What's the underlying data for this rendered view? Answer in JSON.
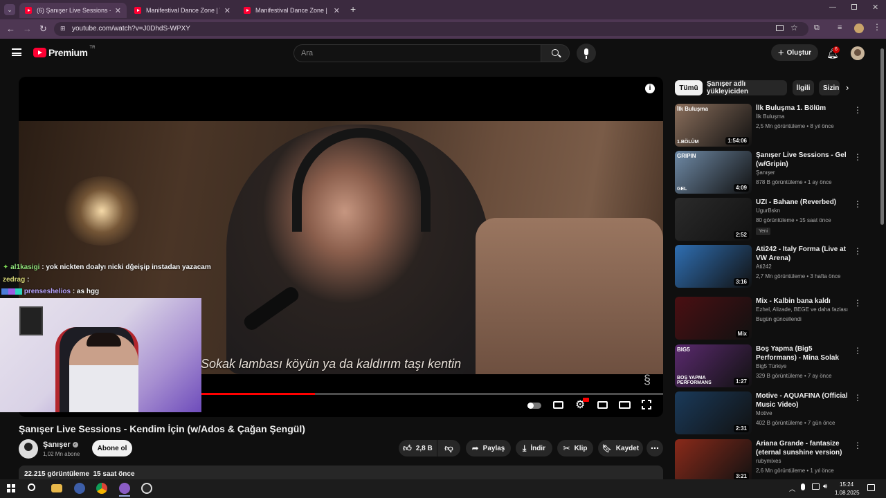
{
  "browser": {
    "tabs": [
      {
        "title": "(6) Şanışer Live Sessions - Kend",
        "active": true
      },
      {
        "title": "Manifestival Dance Zone | Tean",
        "active": false
      },
      {
        "title": "Manifestival Dance Zone | Big-I",
        "active": false
      }
    ],
    "url": "youtube.com/watch?v=J0DhdS-WPXY"
  },
  "header": {
    "logo": "Premium",
    "region": "TR",
    "search_placeholder": "Ara",
    "create_label": "Oluştur",
    "notif_count": "6"
  },
  "player": {
    "subtitle": "Sokak lambası köyün ya da kaldırım taşı kentin",
    "progress_fraction": 0.46
  },
  "chat": [
    {
      "user": "al1kasigi",
      "text": ": yok nickten doalyı nicki dğeişip instadan yazacam"
    },
    {
      "user": "zedrag",
      "text": ":"
    },
    {
      "user": "prenseshelios",
      "text": ": as hgg"
    }
  ],
  "video": {
    "title": "Şanışer Live Sessions - Kendim İçin (w/Ados & Çağan Şengül)",
    "channel": "Şanışer",
    "subscribers": "1,02 Mn abone",
    "subscribe_label": "Abone ol",
    "likes": "2,8 B",
    "share_label": "Paylaş",
    "download_label": "İndir",
    "clip_label": "Klip",
    "save_label": "Kaydet",
    "views": "22.215 görüntüleme",
    "published": "15 saat önce"
  },
  "chips": [
    "Tümü",
    "Şanışer adlı yükleyiciden",
    "İlgili",
    "Sizin"
  ],
  "recommendations": [
    {
      "title": "İlk Buluşma 1. Bölüm",
      "channel": "İlk Buluşma",
      "meta": "2,5 Mn görüntüleme • 8 yıl önce",
      "duration": "1:54:06",
      "thumb_label": "İlk Buluşma",
      "thumb_label2": "1.BÖLÜM",
      "thumb_color": "#8b6f5c"
    },
    {
      "title": "Şanışer Live Sessions - Gel (w/Gripin)",
      "channel": "Şanışer",
      "meta": "878 B görüntüleme • 1 ay önce",
      "duration": "4:09",
      "thumb_label": "GRIPIN",
      "thumb_label2": "GEL",
      "thumb_color": "#6f8aa6"
    },
    {
      "title": "UZI - Bahane (Reverbed)",
      "channel": "UgurBskn",
      "meta": "80 görüntüleme • 15 saat önce",
      "duration": "2:52",
      "badge": "Yeni",
      "thumb_color": "#2b2b2b"
    },
    {
      "title": "Ati242 - Italy Forma (Live at VW Arena)",
      "channel": "Ati242",
      "meta": "2,7 Mn görüntüleme • 3 hafta önce",
      "duration": "3:16",
      "thumb_color": "#2f6fb3"
    },
    {
      "title": "Mix - Kalbin bana kaldı",
      "channel": "Ezhel, Alizade, BEGE ve daha fazlası",
      "meta": "Bugün güncellendi",
      "duration": "Mix",
      "thumb_color": "#4a0f12"
    },
    {
      "title": "Boş Yapma (Big5 Performans) - Mina Solak",
      "channel": "Big5 Türkiye",
      "meta": "329 B görüntüleme • 7 ay önce",
      "duration": "1:27",
      "thumb_label": "BIG5",
      "thumb_label2": "BOŞ YAPMA PERFORMANS",
      "thumb_color": "#5a2a6e"
    },
    {
      "title": "Motive - AQUAFINA (Official Music Video)",
      "channel": "Motive",
      "meta": "402 B görüntüleme • 7 gün önce",
      "duration": "2:31",
      "thumb_color": "#1a3a5a"
    },
    {
      "title": "Ariana Grande - fantasize (eternal sunshine version)",
      "channel": "rubymixes",
      "meta": "2,6 Mn görüntüleme • 1 yıl önce",
      "duration": "3:21",
      "thumb_color": "#8a2a1a"
    }
  ],
  "taskbar": {
    "time": "15:24",
    "date": "1.08.2025"
  }
}
